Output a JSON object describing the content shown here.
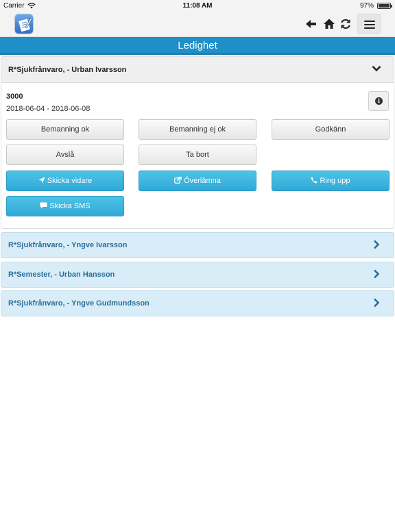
{
  "statusbar": {
    "carrier": "Carrier",
    "time": "11:08 AM",
    "battery": "97%",
    "battery_level": 0.97
  },
  "header": {
    "icons": [
      "app-logo-icon",
      "arrow-left-icon",
      "home-icon",
      "refresh-icon",
      "hamburger-menu-icon"
    ]
  },
  "title": "Ledighet",
  "colors": {
    "brand": "#1f8fc8",
    "info_button": "#3ab4de",
    "collapsed_panel": "#d8edf8"
  },
  "expanded": {
    "title": "R*Sjukfrånvaro, - Urban Ivarsson",
    "code": "3000",
    "dates": "2018-06-04 - 2018-06-08",
    "buttons": {
      "bemanning_ok": "Bemanning ok",
      "bemanning_ej_ok": "Bemanning ej ok",
      "godkann": "Godkänn",
      "avsla": "Avslå",
      "ta_bort": "Ta bort",
      "skicka_vidare": "Skicka vidare",
      "overlamna": "Överlämna",
      "ring_upp": "Ring upp",
      "skicka_sms": "Skicka SMS"
    }
  },
  "items": [
    {
      "title": "R*Sjukfrånvaro, - Yngve Ivarsson"
    },
    {
      "title": "R*Semester, - Urban Hansson"
    },
    {
      "title": "R*Sjukfrånvaro, - Yngve Gudmundsson"
    }
  ]
}
